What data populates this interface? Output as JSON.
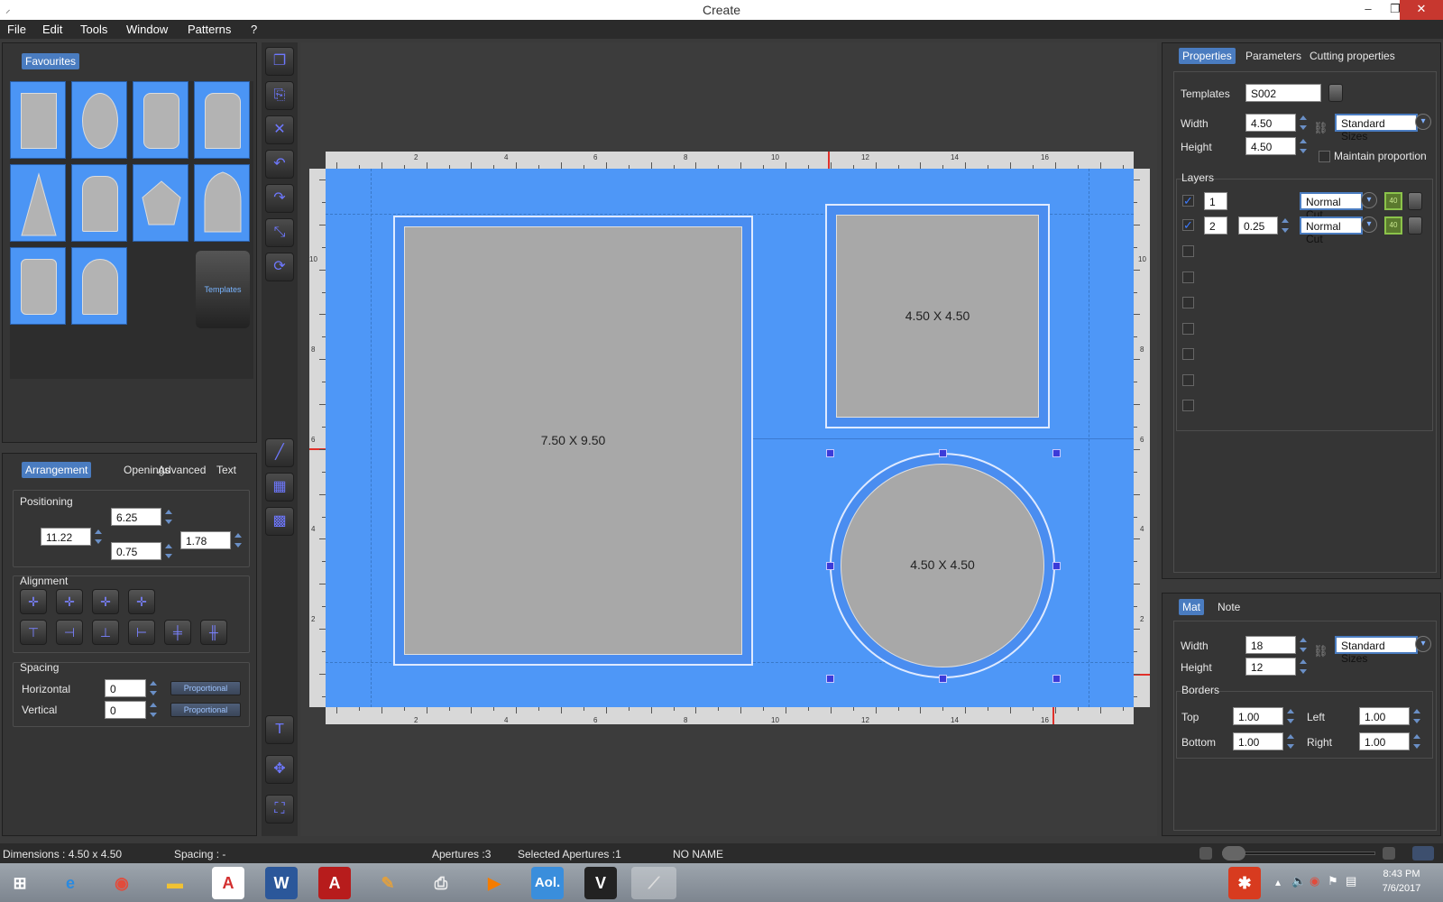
{
  "window": {
    "title": "Create",
    "minimize": "–",
    "restore": "❐",
    "close": "✕"
  },
  "menu": [
    "File",
    "Edit",
    "Tools",
    "Window",
    "Patterns",
    "?"
  ],
  "favourites": {
    "tab": "Favourites",
    "templates_button": "Templates"
  },
  "arrangement_tabs": [
    "Arrangement",
    "Openings",
    "Advanced",
    "Text"
  ],
  "positioning": {
    "title": "Positioning",
    "top": "6.25",
    "left": "11.22",
    "bottom": "0.75",
    "right": "1.78"
  },
  "alignment": {
    "title": "Alignment"
  },
  "spacing": {
    "title": "Spacing",
    "horizontal_label": "Horizontal",
    "horizontal_value": "0",
    "vertical_label": "Vertical",
    "vertical_value": "0",
    "proportional": "Proportional"
  },
  "canvas": {
    "ruler_labels": [
      "2",
      "4",
      "6",
      "8",
      "10",
      "12",
      "14",
      "16"
    ],
    "side_labels": [
      "10",
      "8",
      "6",
      "4",
      "2"
    ],
    "openings": [
      {
        "label": "7.50 X 9.50",
        "shape": "rectangle"
      },
      {
        "label": "4.50 X 4.50",
        "shape": "square"
      },
      {
        "label": "4.50 X 4.50",
        "shape": "circle",
        "selected": true
      }
    ]
  },
  "properties_tabs": [
    "Properties",
    "Parameters",
    "Cutting properties"
  ],
  "properties": {
    "templates_label": "Templates",
    "templates_value": "S002",
    "width_label": "Width",
    "width_value": "4.50",
    "height_label": "Height",
    "height_value": "4.50",
    "standard_sizes": "Standard Sizes",
    "maintain_proportion": "Maintain proportion"
  },
  "layers": {
    "title": "Layers",
    "rows": [
      {
        "number": "1",
        "offset": "",
        "cut": "Normal Cut",
        "checked": "true",
        "badge": "40"
      },
      {
        "number": "2",
        "offset": "0.25",
        "cut": "Normal Cut",
        "checked": "true",
        "badge": "40"
      }
    ]
  },
  "mat_tabs": [
    "Mat",
    "Note"
  ],
  "mat": {
    "width_label": "Width",
    "width_value": "18",
    "height_label": "Height",
    "height_value": "12",
    "standard_sizes": "Standard Sizes",
    "borders_title": "Borders",
    "top_label": "Top",
    "top_value": "1.00",
    "left_label": "Left",
    "left_value": "1.00",
    "bottom_label": "Bottom",
    "bottom_value": "1.00",
    "right_label": "Right",
    "right_value": "1.00"
  },
  "status": {
    "dimensions": "Dimensions : 4.50 x 4.50",
    "spacing": "Spacing :  -",
    "apertures": "Apertures :3",
    "selected": "Selected Apertures :1",
    "name": "NO NAME"
  },
  "taskbar": {
    "time": "8:43 PM",
    "date": "7/6/2017",
    "apps": [
      "windows-start",
      "internet-explorer",
      "chrome",
      "file-explorer",
      "acrobat",
      "word",
      "acrobat-pro",
      "paint",
      "scanner",
      "media-player",
      "aol",
      "vectorworks",
      "mat-designer"
    ]
  },
  "colors": {
    "mat_blue": "#4e97f7",
    "opening_gray": "#a8a8a8",
    "accent": "#4a7cc0"
  }
}
